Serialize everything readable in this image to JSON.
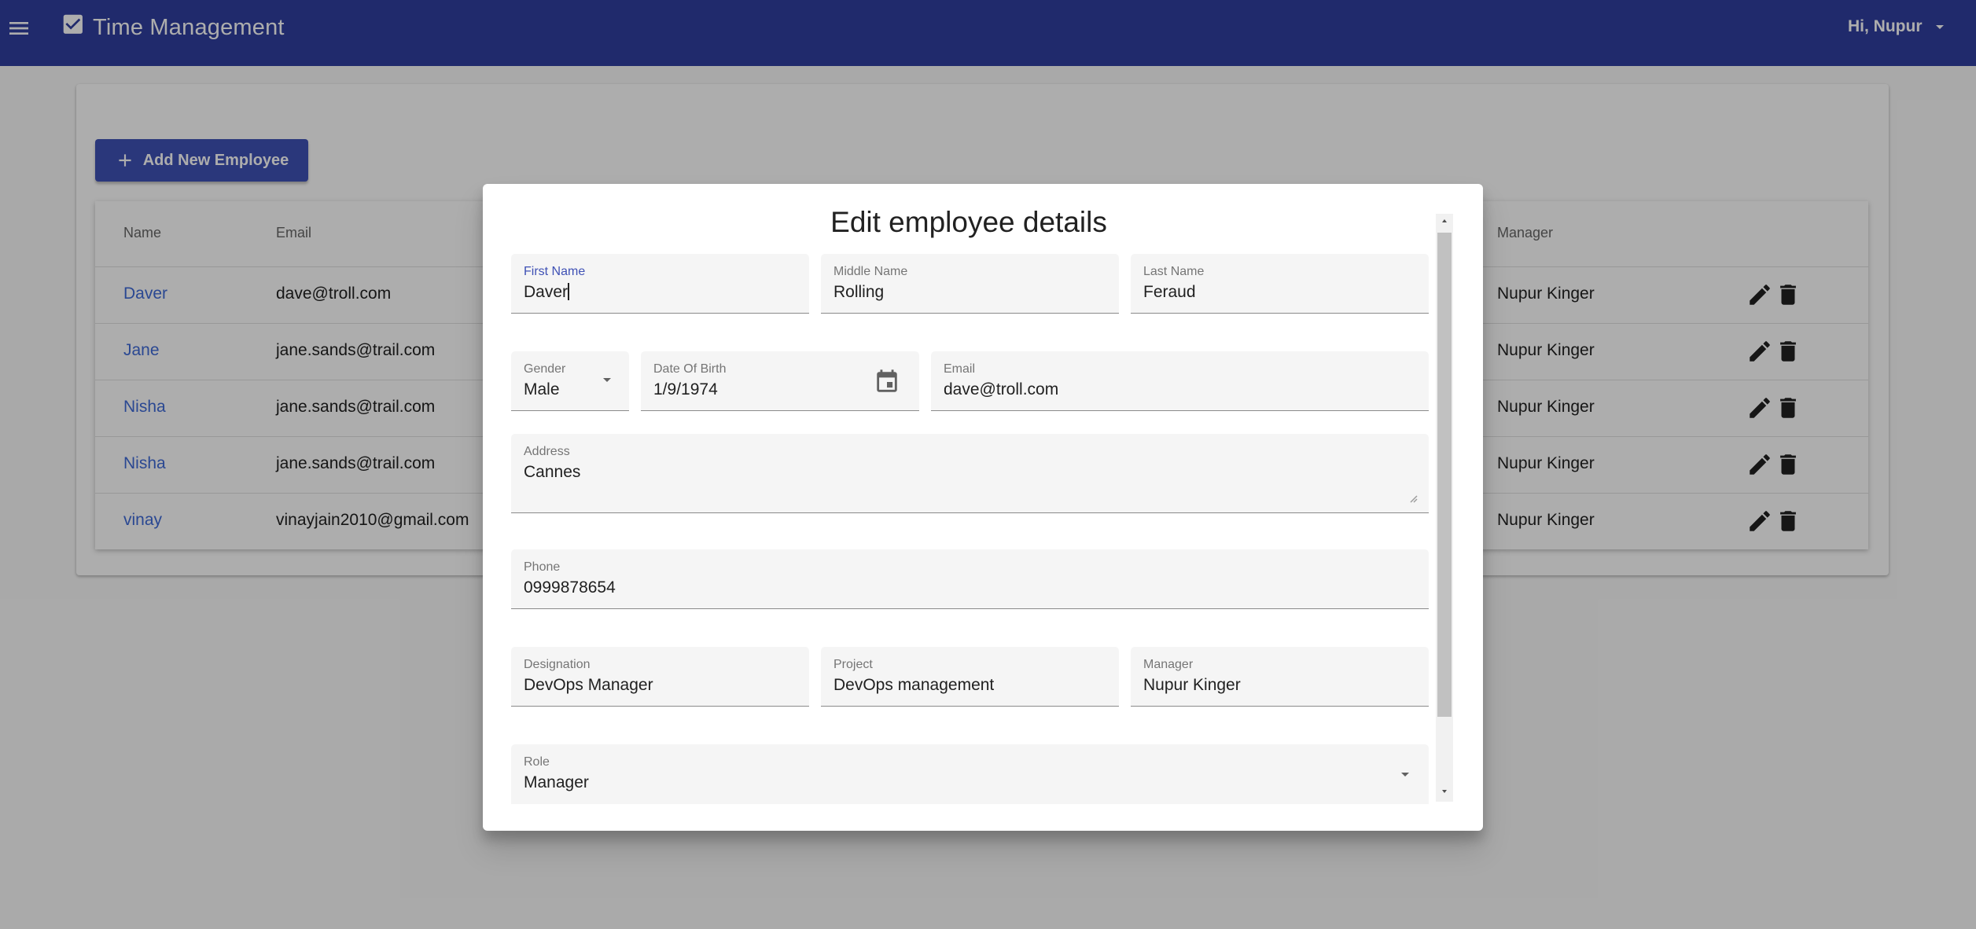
{
  "app": {
    "title": "Time Management",
    "greeting": "Hi, Nupur",
    "bar_color": "#303f9f"
  },
  "page": {
    "add_button_label": "Add New Employee",
    "table": {
      "headers": {
        "name": "Name",
        "email": "Email",
        "manager": "Manager"
      },
      "rows": [
        {
          "name": "Daver",
          "email": "dave@troll.com",
          "manager": "Nupur Kinger"
        },
        {
          "name": "Jane",
          "email": "jane.sands@trail.com",
          "manager": "Nupur Kinger"
        },
        {
          "name": "Nisha",
          "email": "jane.sands@trail.com",
          "manager": "Nupur Kinger"
        },
        {
          "name": "Nisha",
          "email": "jane.sands@trail.com",
          "manager": "Nupur Kinger"
        },
        {
          "name": "vinay",
          "email": "vinayjain2010@gmail.com",
          "manager": "Nupur Kinger"
        }
      ]
    }
  },
  "dialog": {
    "title": "Edit employee details",
    "first_name": {
      "label": "First Name",
      "value": "Daver"
    },
    "middle_name": {
      "label": "Middle Name",
      "value": "Rolling"
    },
    "last_name": {
      "label": "Last Name",
      "value": "Feraud"
    },
    "gender": {
      "label": "Gender",
      "value": "Male"
    },
    "dob": {
      "label": "Date Of Birth",
      "value": "1/9/1974"
    },
    "email": {
      "label": "Email",
      "value": "dave@troll.com"
    },
    "address": {
      "label": "Address",
      "value": "Cannes"
    },
    "phone": {
      "label": "Phone",
      "value": "0999878654"
    },
    "designation": {
      "label": "Designation",
      "value": "DevOps Manager"
    },
    "project": {
      "label": "Project",
      "value": "DevOps management"
    },
    "manager": {
      "label": "Manager",
      "value": "Nupur Kinger"
    },
    "role": {
      "label": "Role",
      "value": "Manager"
    }
  },
  "icons": {
    "menu": "menu-icon",
    "logo": "checklist-icon",
    "user_menu": "chevron-down-icon",
    "add": "plus-icon",
    "edit": "pencil-icon",
    "delete": "trash-icon",
    "calendar": "calendar-icon",
    "dropdown": "chevron-down-icon"
  },
  "colors": {
    "primary": "#3f51b5",
    "link": "#3f6ad8",
    "focused_label": "#3f51b5"
  }
}
